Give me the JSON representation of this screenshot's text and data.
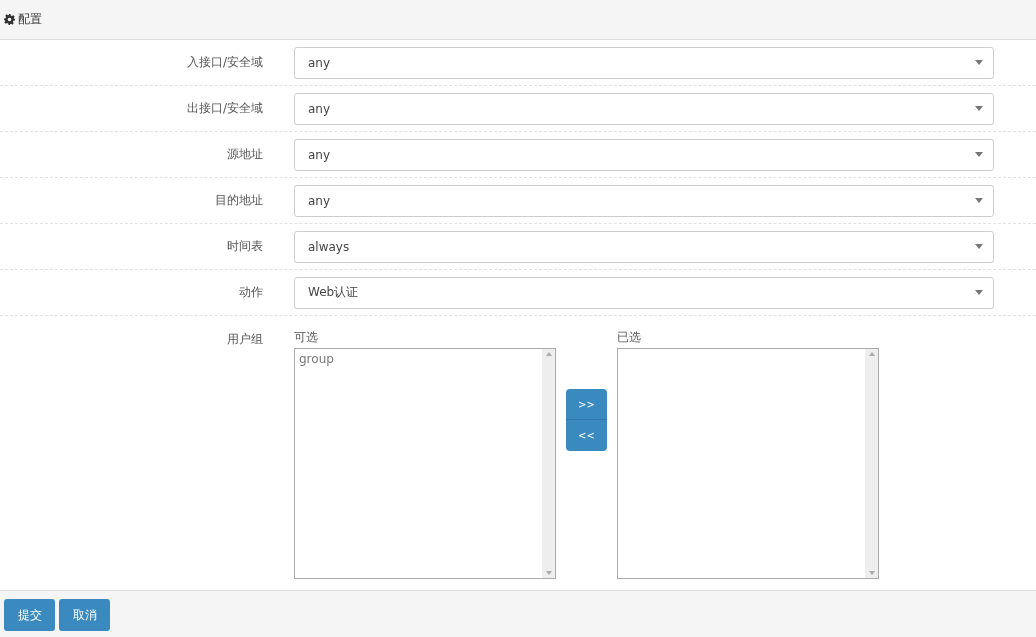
{
  "panel": {
    "title": "配置"
  },
  "fields": [
    {
      "label": "入接口/安全域",
      "value": "any"
    },
    {
      "label": "出接口/安全域",
      "value": "any"
    },
    {
      "label": "源地址",
      "value": "any"
    },
    {
      "label": "目的地址",
      "value": "any"
    },
    {
      "label": "时间表",
      "value": "always"
    },
    {
      "label": "动作",
      "value": "Web认证"
    }
  ],
  "user_group": {
    "label": "用户组",
    "available": {
      "title": "可选",
      "items": [
        "group"
      ]
    },
    "selected": {
      "title": "已选"
    },
    "move_buttons": [
      ">>",
      "<<"
    ]
  },
  "buttons": [
    "提交",
    "取消"
  ]
}
